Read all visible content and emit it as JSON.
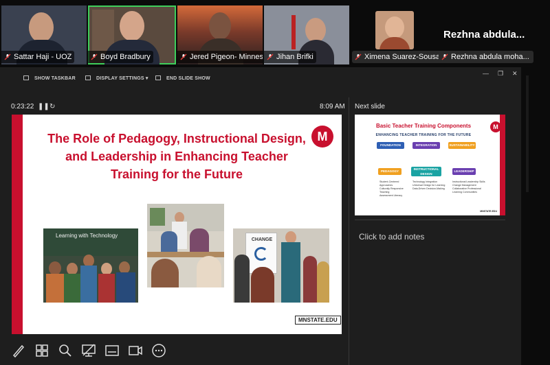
{
  "participants": [
    {
      "name": "Sattar Haji - UOZ"
    },
    {
      "name": "Boyd Bradbury"
    },
    {
      "name": "Jered Pigeon- Minnes..."
    },
    {
      "name": "Jihan Brifki"
    },
    {
      "name": "Ximena Suarez-Sousa"
    },
    {
      "name": "Rezhna abdula moha..."
    }
  ],
  "speaker_display_name": "Rezhna abdula...",
  "toolbar": {
    "show_taskbar": "SHOW TASKBAR",
    "display_settings": "DISPLAY SETTINGS ▾",
    "end_slide_show": "END SLIDE SHOW"
  },
  "timer": "0:23:22",
  "clock": "8:09 AM",
  "next_slide_label": "Next slide",
  "notes_placeholder": "Click to add notes",
  "current_slide": {
    "title_line1": "The Role of Pedagogy, Instructional Design,",
    "title_line2": "and Leadership in Enhancing Teacher",
    "title_line3": "Training for the Future",
    "photo1_caption": "Learning with Technology",
    "photo3_caption": "CHANGE",
    "footer": "MNSTATE.EDU",
    "logo": "M"
  },
  "next_slide": {
    "title": "Basic Teacher Training Components",
    "subtitle": "ENHANCING TEACHER TRAINING FOR THE FUTURE",
    "top_pills": [
      "FOUNDATION",
      "INTEGRATION",
      "SUSTAINABILITY"
    ],
    "columns": [
      {
        "label": "PEDAGOGY",
        "bullets": [
          "Student-Centered Approaches",
          "Culturally Responsive Teaching",
          "Assessment Literacy"
        ]
      },
      {
        "label": "INSTRUCTIONAL DESIGN",
        "bullets": [
          "Technology Integration",
          "Universal Design for Learning",
          "Data-Driven Decision-Making"
        ]
      },
      {
        "label": "LEADERSHIP",
        "bullets": [
          "Instructional Leadership Skills",
          "Change Management",
          "Collaborative Professional Learning Communities"
        ]
      }
    ],
    "footer": "MNSTATE.EDU",
    "logo": "M"
  },
  "colors": {
    "brand_red": "#c8102e",
    "active_speaker": "#3ecf5b",
    "pill_blue": "#2e5fb4",
    "pill_purple": "#6a3fb0",
    "pill_orange": "#f0a020",
    "pill_teal": "#1aa3a3"
  }
}
